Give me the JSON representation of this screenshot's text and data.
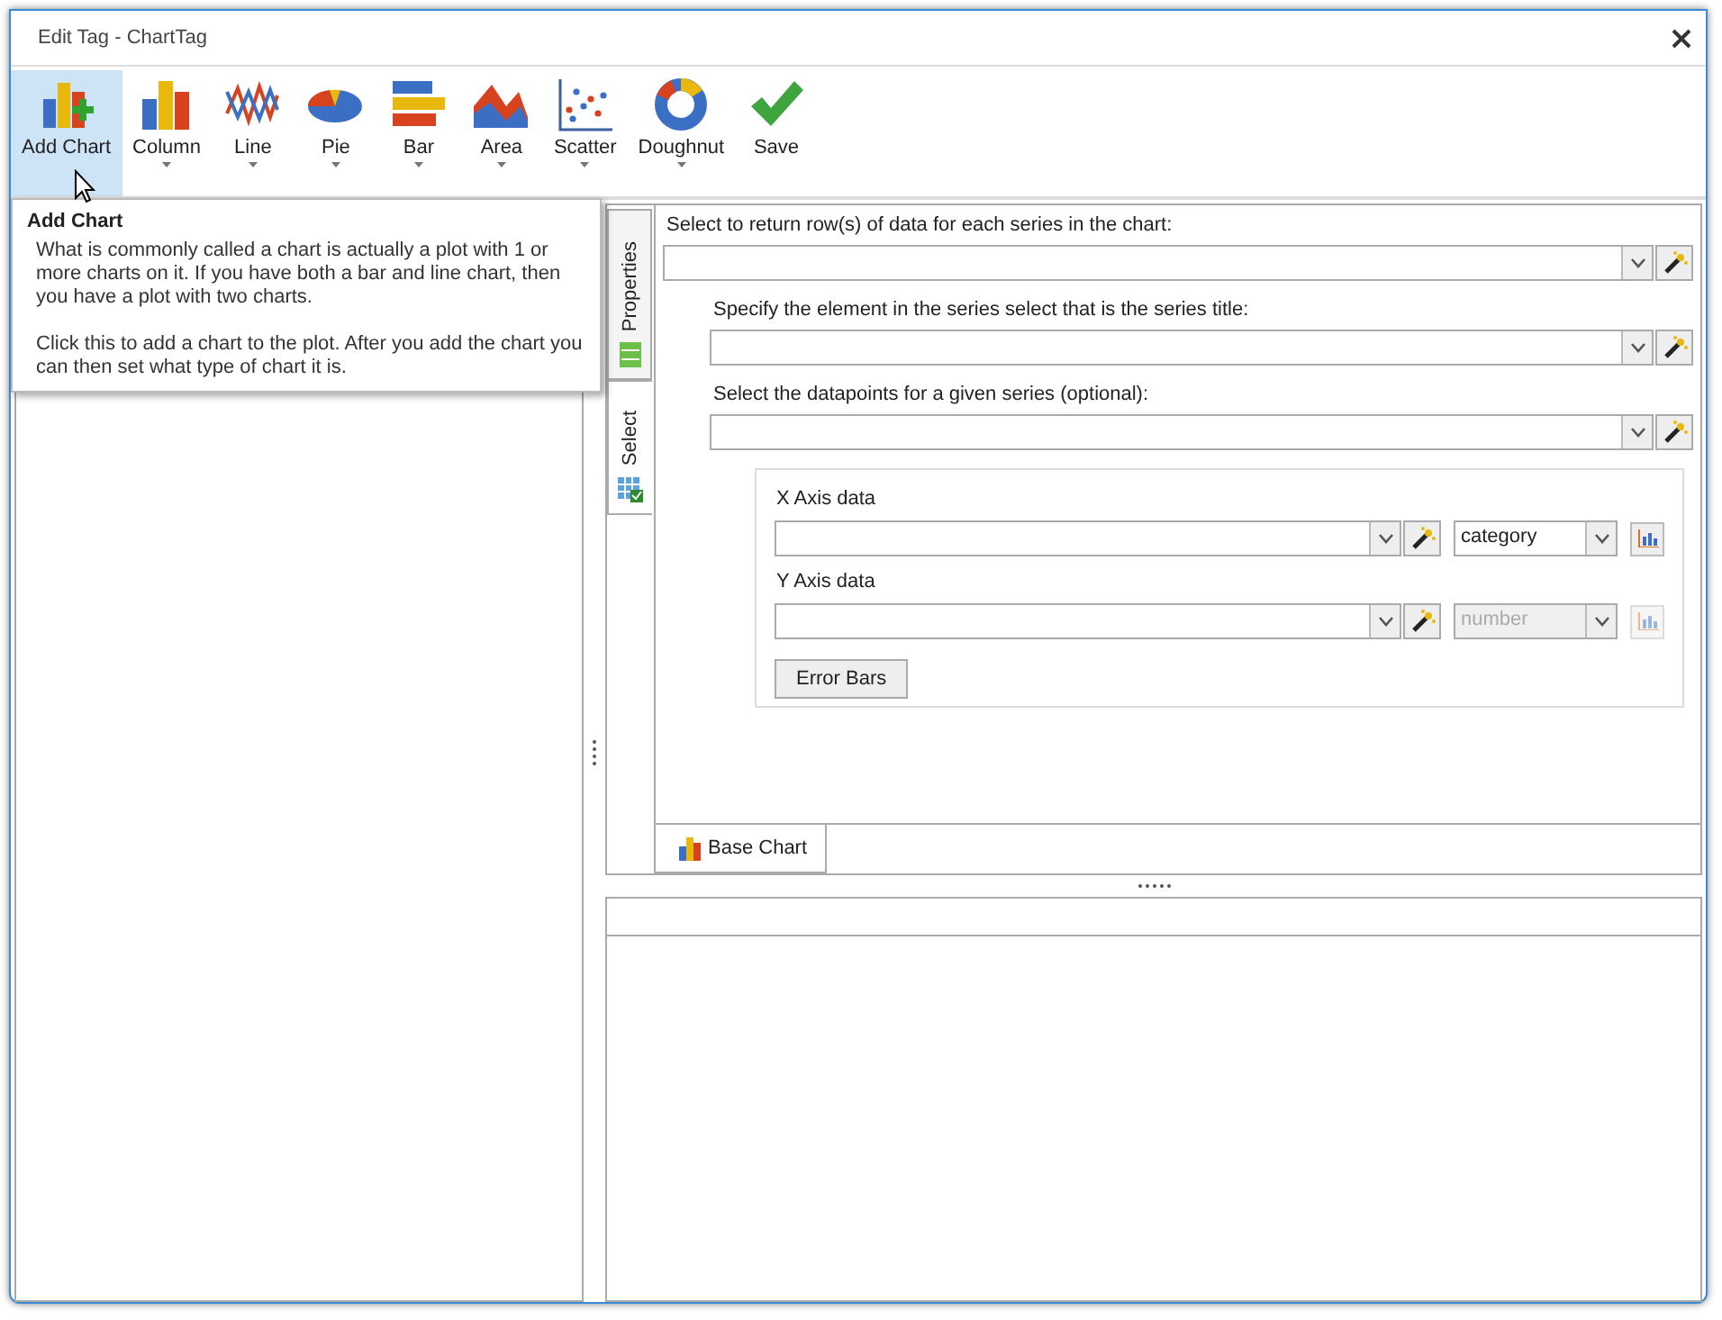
{
  "window": {
    "title": "Edit Tag - ChartTag"
  },
  "toolbar": {
    "buttons": [
      {
        "kind": "add",
        "label": "Add Chart",
        "dropdown": false,
        "selected": true
      },
      {
        "kind": "column",
        "label": "Column",
        "dropdown": true,
        "selected": false
      },
      {
        "kind": "line",
        "label": "Line",
        "dropdown": true,
        "selected": false
      },
      {
        "kind": "pie",
        "label": "Pie",
        "dropdown": true,
        "selected": false
      },
      {
        "kind": "bar",
        "label": "Bar",
        "dropdown": true,
        "selected": false
      },
      {
        "kind": "area",
        "label": "Area",
        "dropdown": true,
        "selected": false
      },
      {
        "kind": "scatter",
        "label": "Scatter",
        "dropdown": true,
        "selected": false
      },
      {
        "kind": "doughnut",
        "label": "Doughnut",
        "dropdown": true,
        "selected": false
      },
      {
        "kind": "save",
        "label": "Save",
        "dropdown": false,
        "selected": false
      }
    ]
  },
  "tooltip": {
    "title": "Add Chart",
    "paragraphs": [
      "What is commonly called a chart is actually a plot with 1 or more charts on it. If you have both a bar and line chart, then you have a plot with two charts.",
      "Click this to add a chart to the plot. After you add the chart you can then set what type of chart it is."
    ]
  },
  "side_tabs": [
    {
      "kind": "properties",
      "label": "Properties",
      "selected": false
    },
    {
      "kind": "select",
      "label": "Select",
      "selected": true
    }
  ],
  "series_fields": [
    {
      "label": "Select to return row(s) of data for each series in the chart:",
      "indented": false
    },
    {
      "label": "Specify the element in the series select that is the series title:",
      "indented": true
    },
    {
      "label": "Select the datapoints for a given series (optional):",
      "indented": true
    }
  ],
  "axes": [
    {
      "label": "X Axis data",
      "type_value": "category",
      "disabled": false
    },
    {
      "label": "Y Axis data",
      "type_value": "number",
      "disabled": true
    }
  ],
  "error_bars_button": "Error Bars",
  "bottom_tabs": [
    {
      "label": "Base Chart",
      "selected": true
    }
  ]
}
